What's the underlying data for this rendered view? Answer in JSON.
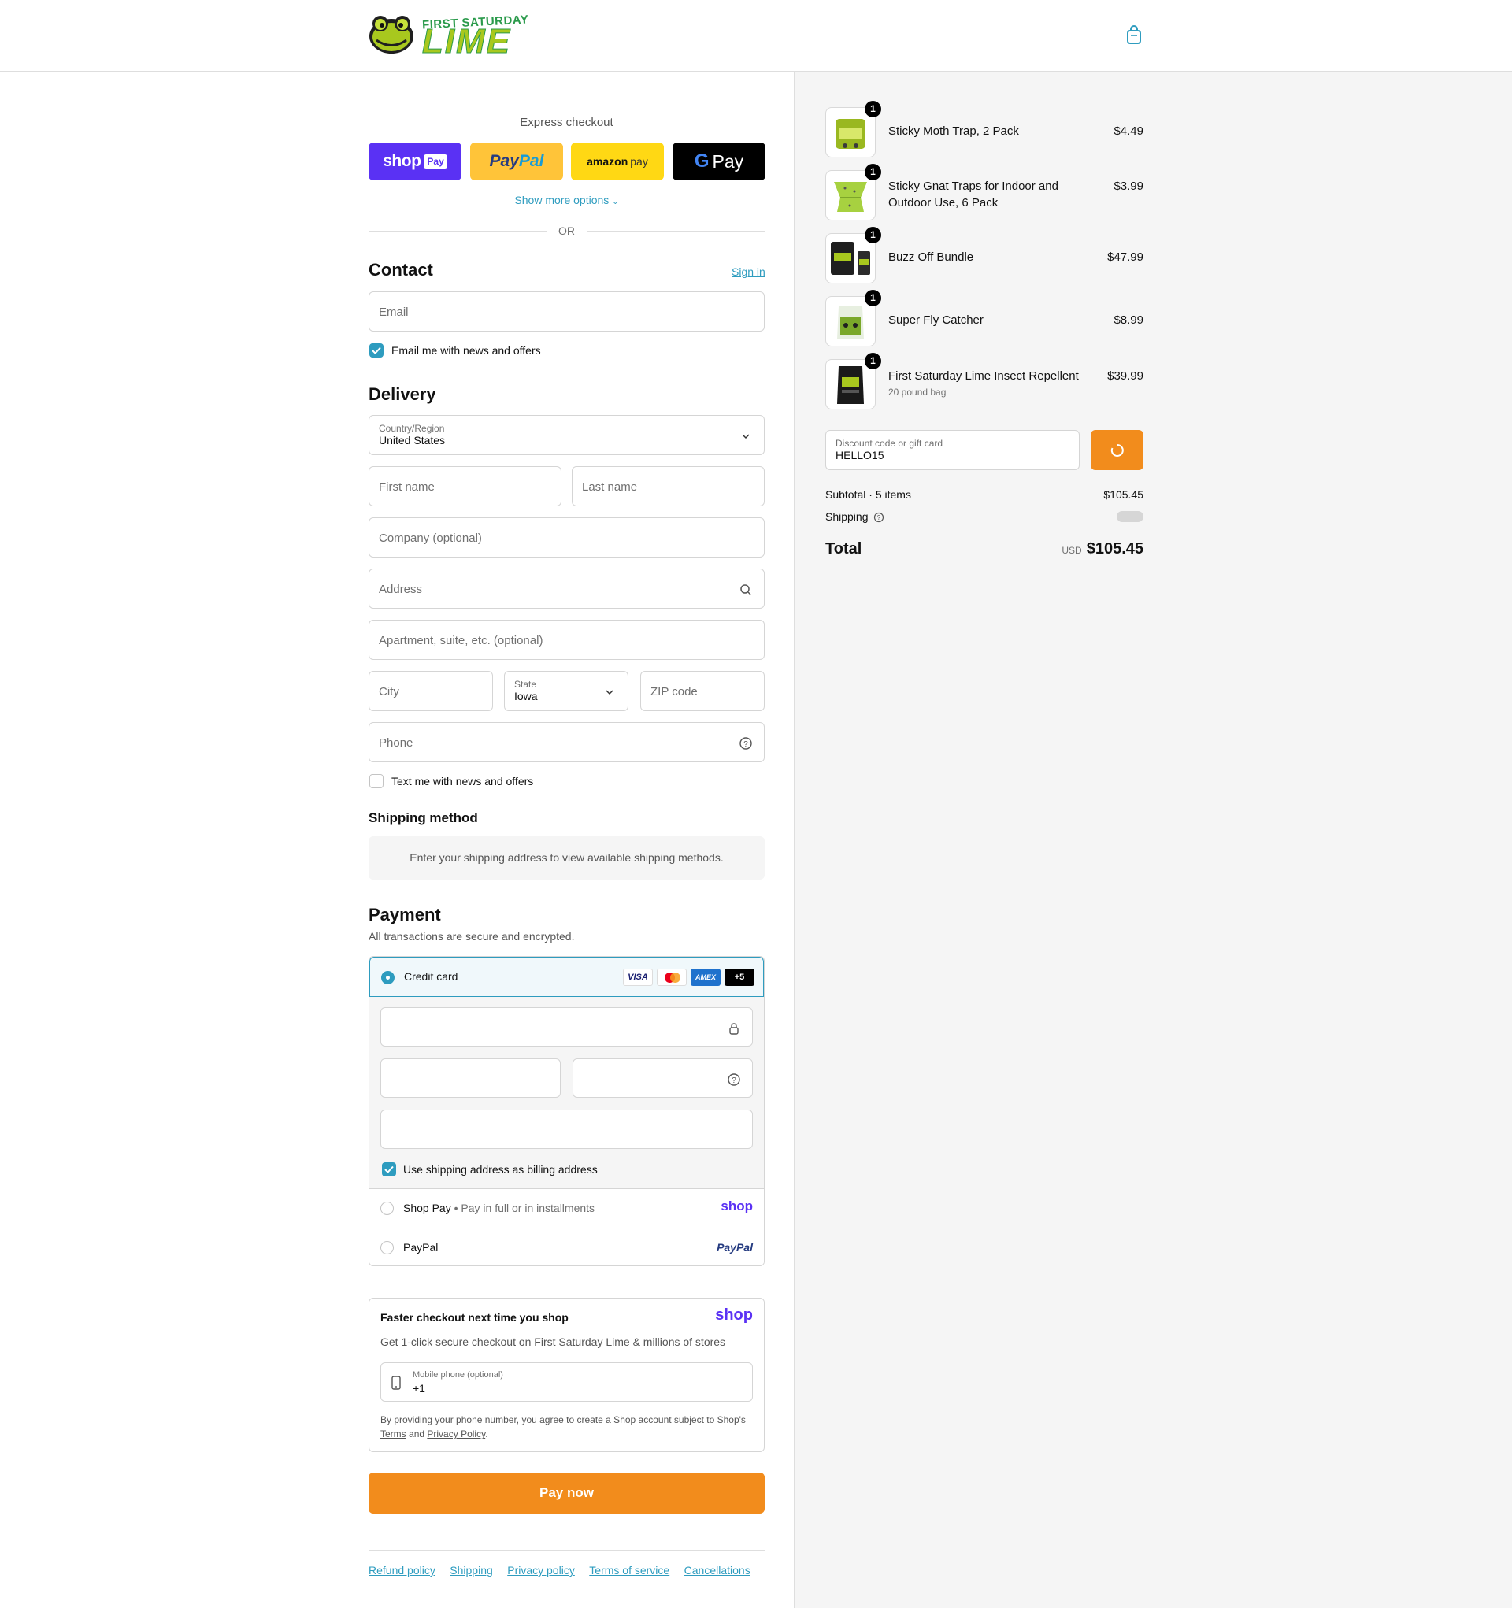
{
  "header": {
    "logo_top": "FIRST SATURDAY",
    "logo_main": "LIME"
  },
  "express": {
    "title": "Express checkout",
    "shop_pay": {
      "word": "shop",
      "tag": "Pay"
    },
    "paypal": {
      "pay": "Pay",
      "pal": "Pal"
    },
    "amazon_pay": {
      "amazon": "amazon",
      "pay": "pay"
    },
    "gpay": {
      "g": "G",
      "pay": "Pay"
    },
    "show_more": "Show more options",
    "or": "OR"
  },
  "contact": {
    "heading": "Contact",
    "sign_in": "Sign in",
    "email_placeholder": "Email",
    "news_checkbox": "Email me with news and offers",
    "news_checked": true
  },
  "delivery": {
    "heading": "Delivery",
    "country_label": "Country/Region",
    "country_value": "United States",
    "first_name": "First name",
    "last_name": "Last name",
    "company": "Company (optional)",
    "address": "Address",
    "apartment": "Apartment, suite, etc. (optional)",
    "city": "City",
    "state_label": "State",
    "state_value": "Iowa",
    "zip": "ZIP code",
    "phone": "Phone",
    "text_checkbox": "Text me with news and offers",
    "text_checked": false
  },
  "shipping_method": {
    "heading": "Shipping method",
    "message": "Enter your shipping address to view available shipping methods."
  },
  "payment": {
    "heading": "Payment",
    "subtitle": "All transactions are secure and encrypted.",
    "credit_card": "Credit card",
    "card_brands": [
      "VISA",
      "mastercard",
      "AMEX",
      "+5"
    ],
    "billing_checkbox": "Use shipping address as billing address",
    "billing_checked": true,
    "shop_pay_label": "Shop Pay",
    "shop_pay_sub": "Pay in full or in installments",
    "shop_logo": "shop",
    "paypal_label": "PayPal",
    "paypal_logo": "PayPal"
  },
  "shop_promo": {
    "title": "Faster checkout next time you shop",
    "logo": "shop",
    "subtitle": "Get 1-click secure checkout on First Saturday Lime & millions of stores",
    "phone_label": "Mobile phone (optional)",
    "phone_value": "+1",
    "legal_prefix": "By providing your phone number, you agree to create a Shop account subject to Shop's",
    "terms": "Terms",
    "and": "and",
    "privacy": "Privacy Policy",
    "period": "."
  },
  "pay_button": "Pay now",
  "footer_links": [
    "Refund policy",
    "Shipping",
    "Privacy policy",
    "Terms of service",
    "Cancellations"
  ],
  "order": {
    "items": [
      {
        "name": "Sticky Moth Trap, 2 Pack",
        "sub": "",
        "price": "$4.49",
        "qty": "1"
      },
      {
        "name": "Sticky Gnat Traps for Indoor and Outdoor Use, 6 Pack",
        "sub": "",
        "price": "$3.99",
        "qty": "1"
      },
      {
        "name": "Buzz Off Bundle",
        "sub": "",
        "price": "$47.99",
        "qty": "1"
      },
      {
        "name": "Super Fly Catcher",
        "sub": "",
        "price": "$8.99",
        "qty": "1"
      },
      {
        "name": "First Saturday Lime Insect Repellent",
        "sub": "20 pound bag",
        "price": "$39.99",
        "qty": "1"
      }
    ],
    "discount_label": "Discount code or gift card",
    "discount_value": "HELLO15",
    "subtotal_label": "Subtotal · 5 items",
    "subtotal_value": "$105.45",
    "shipping_label": "Shipping",
    "total_label": "Total",
    "currency": "USD",
    "total_value": "$105.45"
  },
  "colors": {
    "accent": "#2e9cbf",
    "orange": "#f28c1c",
    "shop_purple": "#5a31f4",
    "paypal_yellow": "#ffc439",
    "amazon_yellow": "#ffd814"
  }
}
